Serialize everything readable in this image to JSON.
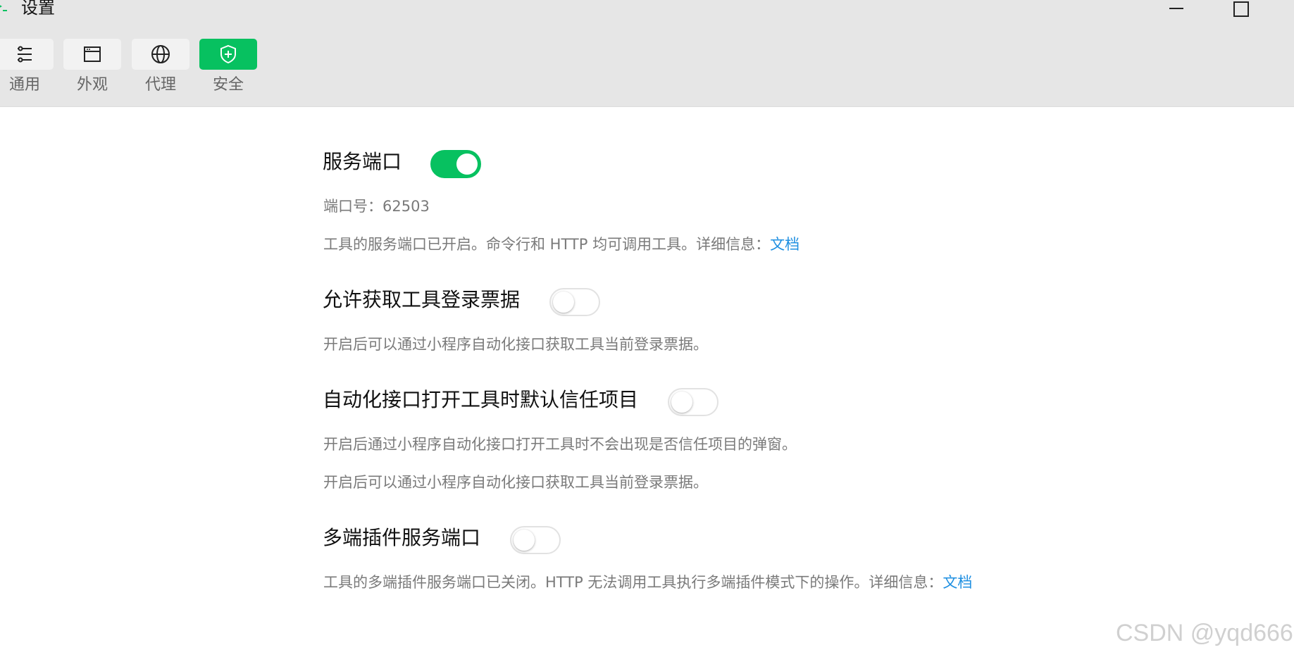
{
  "window": {
    "title": "设置"
  },
  "tabs": [
    {
      "label": "通用",
      "icon": "sliders-icon",
      "active": false
    },
    {
      "label": "外观",
      "icon": "window-icon",
      "active": false
    },
    {
      "label": "代理",
      "icon": "globe-icon",
      "active": false
    },
    {
      "label": "安全",
      "icon": "shield-plus-icon",
      "active": true
    }
  ],
  "sections": {
    "service_port": {
      "title": "服务端口",
      "enabled": true,
      "port_text": "端口号：62503",
      "desc": "工具的服务端口已开启。命令行和 HTTP 均可调用工具。详细信息：",
      "link": "文档"
    },
    "login_ticket": {
      "title": "允许获取工具登录票据",
      "enabled": false,
      "desc": "开启后可以通过小程序自动化接口获取工具当前登录票据。"
    },
    "trust_project": {
      "title": "自动化接口打开工具时默认信任项目",
      "enabled": false,
      "desc1": "开启后通过小程序自动化接口打开工具时不会出现是否信任项目的弹窗。",
      "desc2": "开启后可以通过小程序自动化接口获取工具当前登录票据。"
    },
    "multi_plugin": {
      "title": "多端插件服务端口",
      "enabled": false,
      "desc": "工具的多端插件服务端口已关闭。HTTP 无法调用工具执行多端插件模式下的操作。详细信息：",
      "link": "文档"
    }
  },
  "watermark": "CSDN @yqd666",
  "colors": {
    "accent": "#07c160",
    "link": "#1e8fe1",
    "toolbar_bg": "#e6e6e6"
  }
}
